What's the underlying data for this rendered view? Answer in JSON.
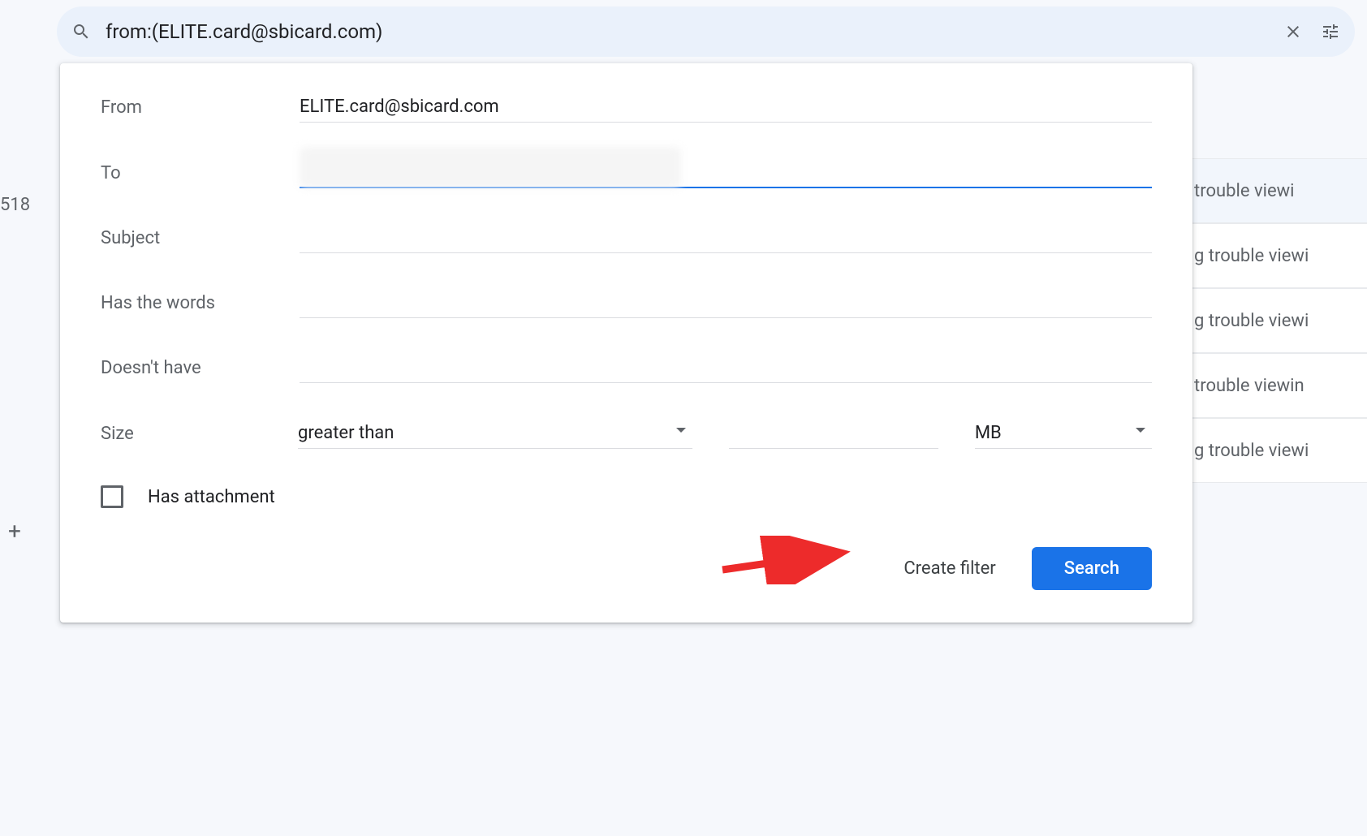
{
  "search": {
    "query": "from:(ELITE.card@sbicard.com)"
  },
  "filter": {
    "from": {
      "label": "From",
      "value": "ELITE.card@sbicard.com"
    },
    "to": {
      "label": "To",
      "value": ""
    },
    "subject": {
      "label": "Subject",
      "value": ""
    },
    "has_words": {
      "label": "Has the words",
      "value": ""
    },
    "doesnt_have": {
      "label": "Doesn't have",
      "value": ""
    },
    "size": {
      "label": "Size",
      "operator": "greater than",
      "value": "",
      "unit": "MB"
    },
    "has_attachment": {
      "label": "Has attachment",
      "checked": false
    },
    "buttons": {
      "create_filter": "Create filter",
      "search": "Search"
    }
  },
  "background": {
    "number": "518",
    "email_snippets": [
      "trouble viewi",
      "g trouble viewi",
      "g trouble viewi",
      "trouble viewin",
      "g trouble viewi"
    ]
  }
}
